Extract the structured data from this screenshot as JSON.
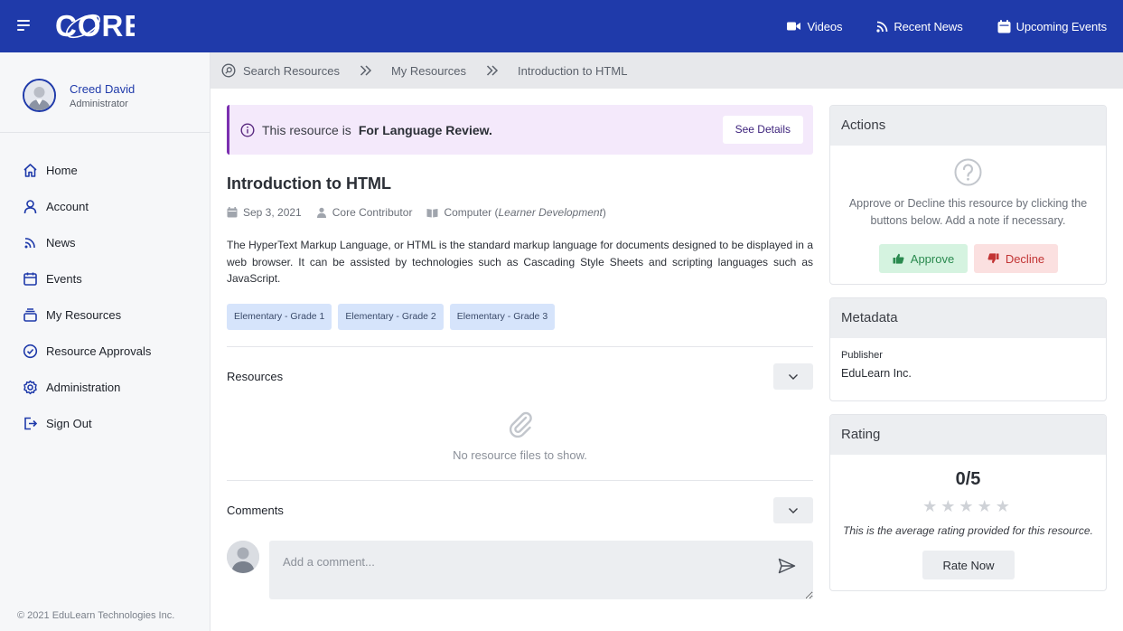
{
  "header": {
    "logo_text": "CORE",
    "nav": [
      {
        "label": "Videos",
        "icon": "video-icon"
      },
      {
        "label": "Recent News",
        "icon": "rss-icon"
      },
      {
        "label": "Upcoming Events",
        "icon": "calendar-icon"
      }
    ]
  },
  "sidebar": {
    "user_name": "Creed David",
    "user_role": "Administrator",
    "items": [
      {
        "label": "Home",
        "icon": "home-icon"
      },
      {
        "label": "Account",
        "icon": "user-icon"
      },
      {
        "label": "News",
        "icon": "rss-icon"
      },
      {
        "label": "Events",
        "icon": "calendar-icon"
      },
      {
        "label": "My Resources",
        "icon": "stack-icon"
      },
      {
        "label": "Resource Approvals",
        "icon": "check-circle-icon"
      },
      {
        "label": "Administration",
        "icon": "gear-icon"
      },
      {
        "label": "Sign Out",
        "icon": "sign-out-icon"
      }
    ],
    "footer": "© 2021 EduLearn Technologies Inc."
  },
  "breadcrumb": [
    "Search Resources",
    "My Resources",
    "Introduction to HTML"
  ],
  "alert": {
    "prefix": "This resource is",
    "status": "For Language Review.",
    "button": "See Details"
  },
  "resource": {
    "title": "Introduction to HTML",
    "date": "Sep 3, 2021",
    "contributor": "Core Contributor",
    "subject": "Computer",
    "subject_category": "Learner Development",
    "description": "The HyperText Markup Language, or HTML is the standard markup language for documents designed to be displayed in a web browser. It can be assisted by technologies such as Cascading Style Sheets and scripting languages such as JavaScript.",
    "tags": [
      "Elementary - Grade 1",
      "Elementary - Grade 2",
      "Elementary - Grade 3"
    ]
  },
  "resources_section": {
    "label": "Resources",
    "empty_text": "No resource files to show."
  },
  "comments_section": {
    "label": "Comments",
    "placeholder": "Add a comment..."
  },
  "actions_panel": {
    "title": "Actions",
    "help": "Approve or Decline this resource by clicking the buttons below. Add a note if necessary.",
    "approve": "Approve",
    "decline": "Decline"
  },
  "metadata_panel": {
    "title": "Metadata",
    "publisher_label": "Publisher",
    "publisher_value": "EduLearn Inc."
  },
  "rating_panel": {
    "title": "Rating",
    "score": "0/5",
    "stars_filled": 0,
    "stars_total": 5,
    "note": "This is the average rating provided for this resource.",
    "button": "Rate Now"
  },
  "colors": {
    "brand": "#1f3aaa",
    "alert_bg": "#f4e9fb",
    "alert_accent": "#7b2fb0",
    "approve": "#2a8a4f",
    "decline": "#c23434"
  }
}
